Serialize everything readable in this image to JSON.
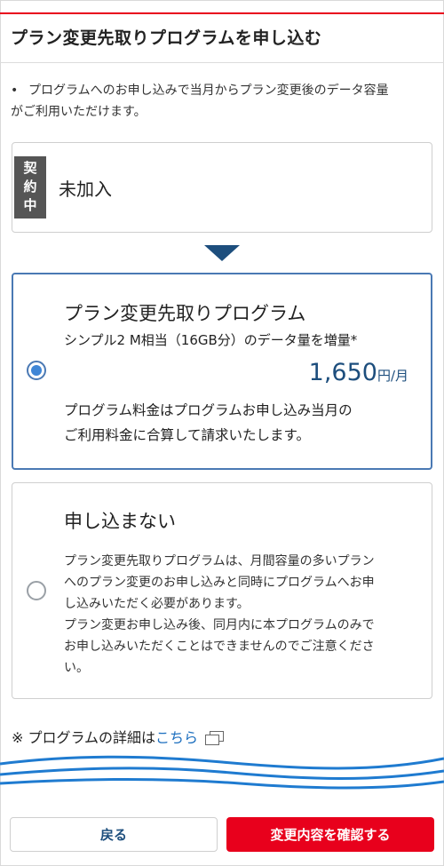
{
  "header": {
    "title": "プラン変更先取りプログラムを申し込む"
  },
  "note": {
    "bullet": "•",
    "line1": "プログラムへのお申し込みで当月からプラン変更後のデータ容量",
    "line2": "がご利用いただけます。"
  },
  "current": {
    "badge": [
      "契",
      "約",
      "中"
    ],
    "status": "未加入"
  },
  "options": [
    {
      "title": "プラン変更先取りプログラム",
      "subtitle": "シンプル2 M相当（16GB分）のデータ量を増量*",
      "price": "1,650",
      "price_unit": "円/月",
      "desc_line1": "プログラム料金はプログラムお申し込み当月の",
      "desc_line2": "ご利用料金に合算して請求いたします。",
      "selected": true
    },
    {
      "title": "申し込まない",
      "desc_lines": [
        "プラン変更先取りプログラムは、月間容量の多いプラン",
        "へのプラン変更のお申し込みと同時にプログラムへお申",
        "し込みいただく必要があります。",
        "プラン変更お申し込み後、同月内に本プログラムのみで",
        "お申し込みいただくことはできませんのでご注意くださ",
        "い。"
      ],
      "selected": false
    }
  ],
  "detail": {
    "prefix": "※ プログラムの詳細は",
    "link": "こちら",
    "icon": "external-link-icon"
  },
  "buttons": {
    "back": "戻る",
    "confirm": "変更内容を確認する"
  },
  "colors": {
    "accent_red": "#e8001c",
    "navy": "#1d4e7d",
    "radio_blue": "#3f86d6",
    "link_blue": "#1d6fbf",
    "wave_blue": "#1f7bd0"
  }
}
